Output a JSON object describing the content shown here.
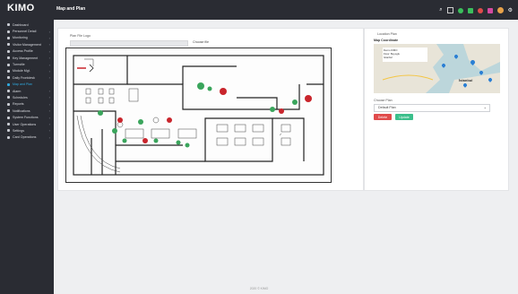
{
  "app": {
    "brand": "KIMO",
    "page_title": "Map and Plan"
  },
  "sidebar": {
    "items": [
      {
        "label": "Dashboard",
        "caret": ""
      },
      {
        "label": "Personnel Detail",
        "caret": "›"
      },
      {
        "label": "Monitoring",
        "caret": "›"
      },
      {
        "label": "Visitor Management",
        "caret": "›"
      },
      {
        "label": "Access Profile",
        "caret": "›"
      },
      {
        "label": "Key Management",
        "caret": "›"
      },
      {
        "label": "Turnstile",
        "caret": "›"
      },
      {
        "label": "Module Mgt.",
        "caret": "›"
      },
      {
        "label": "Daily Frontdesk",
        "caret": "›"
      },
      {
        "label": "Map and Plan",
        "caret": ""
      },
      {
        "label": "Alarm",
        "caret": "›"
      },
      {
        "label": "Schedules",
        "caret": "›"
      },
      {
        "label": "Reports",
        "caret": "›"
      },
      {
        "label": "Notifications",
        "caret": "›"
      },
      {
        "label": "System Functions",
        "caret": "›"
      },
      {
        "label": "User Operations",
        "caret": "›"
      },
      {
        "label": "Settings",
        "caret": "›"
      },
      {
        "label": "Card Operations",
        "caret": "›"
      }
    ],
    "active_index": 9
  },
  "map_panel": {
    "file_label": "Plan File Logo",
    "file_value": "",
    "choose_label": "Choose file"
  },
  "right_panel": {
    "title": "Location Plan",
    "subtitle": "Map Coordinate",
    "map_tooltip": "Demo KIMO\nFloor: Beyoglu\nIstanbul",
    "map_label": "İstanbul",
    "select_label": "Choose Plan",
    "select_value": "Default Plan",
    "delete_label": "Delete",
    "update_label": "Update"
  },
  "footer": {
    "text": "2020 © KIMO"
  },
  "colors": {
    "sidebar_bg": "#2a2c33",
    "active": "#2fa9de",
    "danger": "#e04b4b",
    "success": "#3bbf8b",
    "pin_green": "#3aa55c",
    "pin_red": "#c9252c"
  }
}
